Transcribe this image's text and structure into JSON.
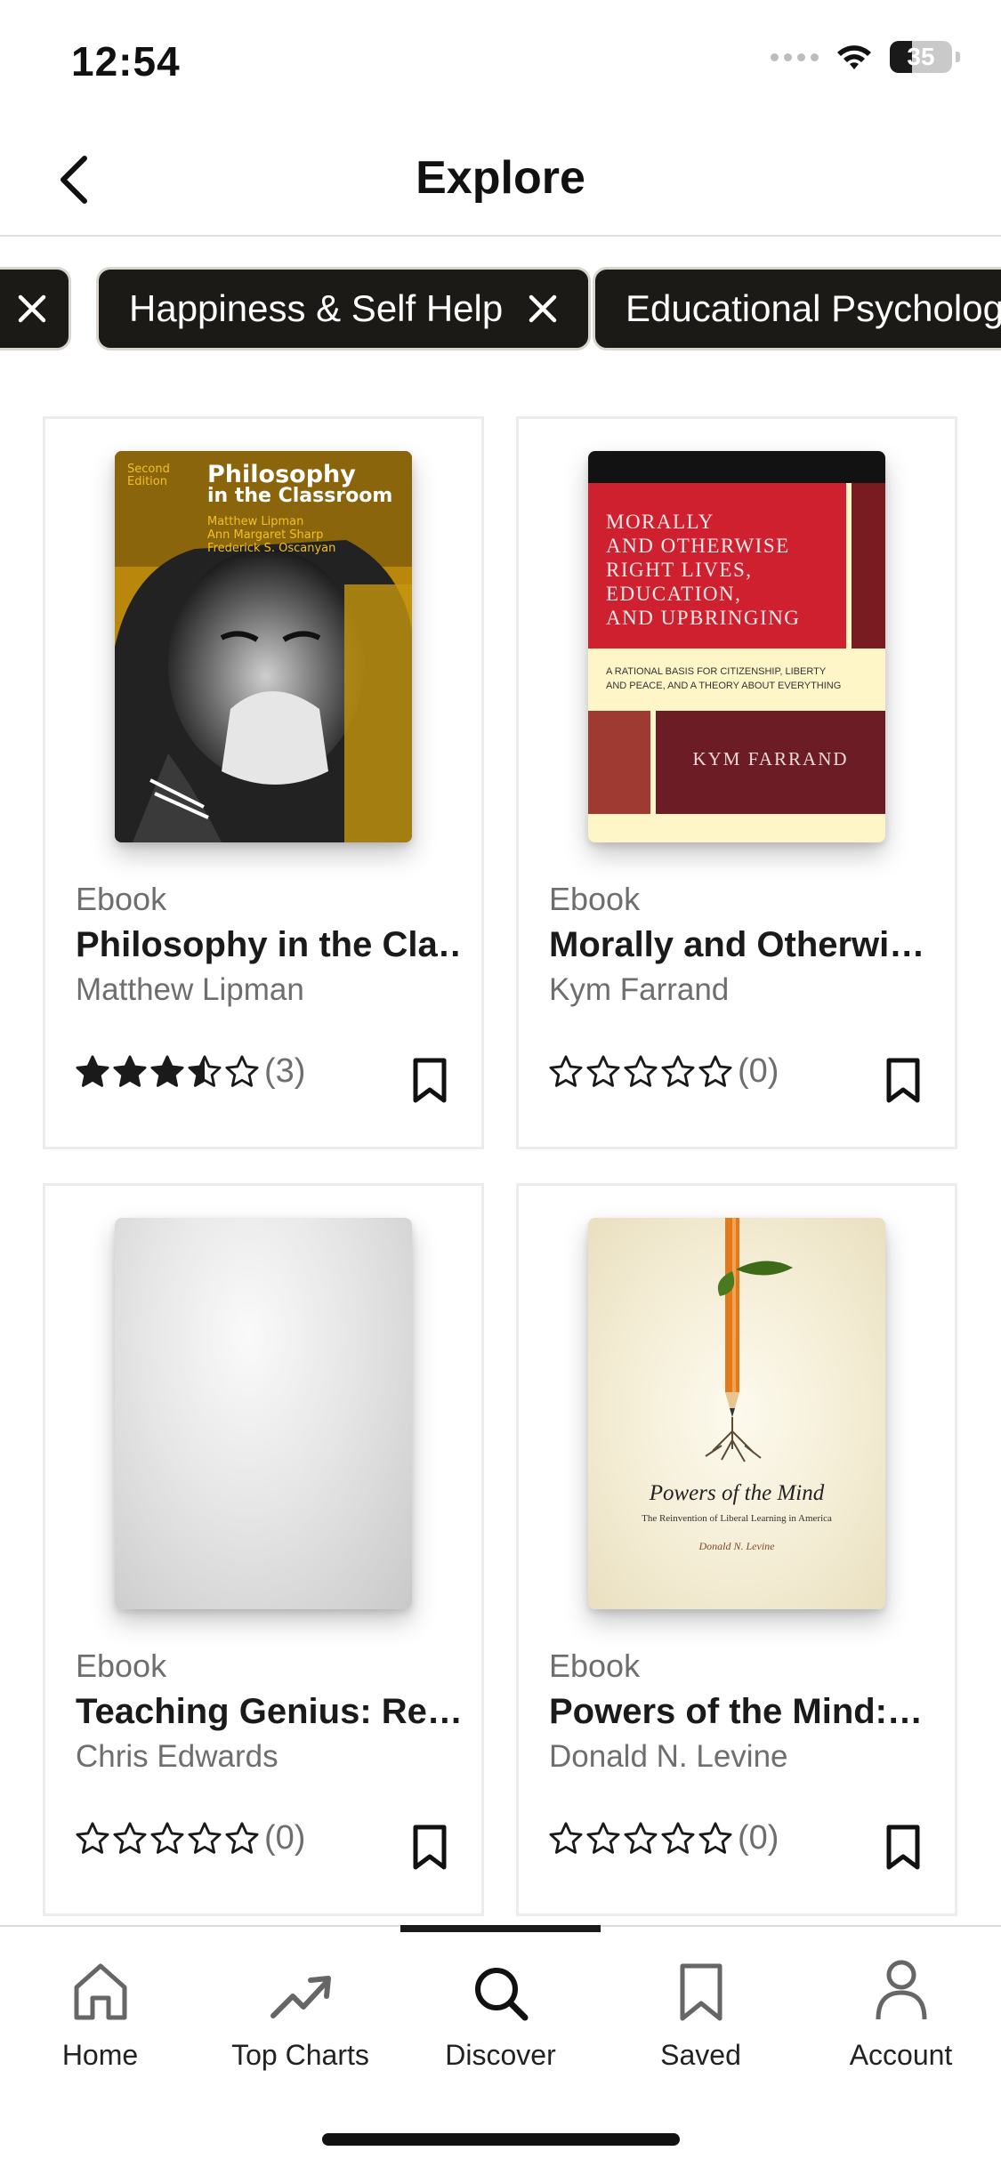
{
  "status": {
    "time": "12:54",
    "battery": "35",
    "battery_level": 0.35
  },
  "header": {
    "title": "Explore"
  },
  "chips": [
    {
      "label": ""
    },
    {
      "label": "Happiness & Self Help"
    },
    {
      "label": "Educational Psychology"
    }
  ],
  "cards": [
    {
      "type": "Ebook",
      "title": "Philosophy in the Cla…",
      "author": "Matthew Lipman",
      "rating": 3.5,
      "count": "(3)",
      "cover": {
        "edition": "Second Edition",
        "title_line1": "Philosophy",
        "title_line2": "in the Classroom",
        "authors": [
          "Matthew Lipman",
          "Ann Margaret Sharp",
          "Frederick S. Oscanyan"
        ]
      }
    },
    {
      "type": "Ebook",
      "title": "Morally and Otherwi…",
      "author": "Kym Farrand",
      "rating": 0,
      "count": "(0)",
      "cover": {
        "title_lines": [
          "MORALLY",
          "AND OTHERWISE",
          "RIGHT LIVES,",
          "EDUCATION,",
          "AND UPBRINGING"
        ],
        "subtitle_lines": [
          "A RATIONAL BASIS FOR CITIZENSHIP, LIBERTY",
          "AND PEACE, AND A THEORY ABOUT EVERYTHING"
        ],
        "author": "KYM FARRAND"
      }
    },
    {
      "type": "Ebook",
      "title": "Teaching Genius: Re…",
      "author": "Chris Edwards",
      "rating": 0,
      "count": "(0)",
      "cover": {}
    },
    {
      "type": "Ebook",
      "title": "Powers of the Mind:…",
      "author": "Donald N. Levine",
      "rating": 0,
      "count": "(0)",
      "cover": {
        "title": "Powers of the Mind",
        "subtitle": "The Reinvention of Liberal Learning in America",
        "author": "Donald N. Levine"
      }
    }
  ],
  "tabs": [
    {
      "label": "Home",
      "icon": "home-icon"
    },
    {
      "label": "Top Charts",
      "icon": "trending-icon"
    },
    {
      "label": "Discover",
      "icon": "search-icon"
    },
    {
      "label": "Saved",
      "icon": "bookmark-icon"
    },
    {
      "label": "Account",
      "icon": "person-icon"
    }
  ],
  "colors": {
    "chip_bg": "#1c1a16",
    "text_primary": "#1a1a1a",
    "text_secondary": "#6e6e6e",
    "star": "#1a1a1a"
  }
}
